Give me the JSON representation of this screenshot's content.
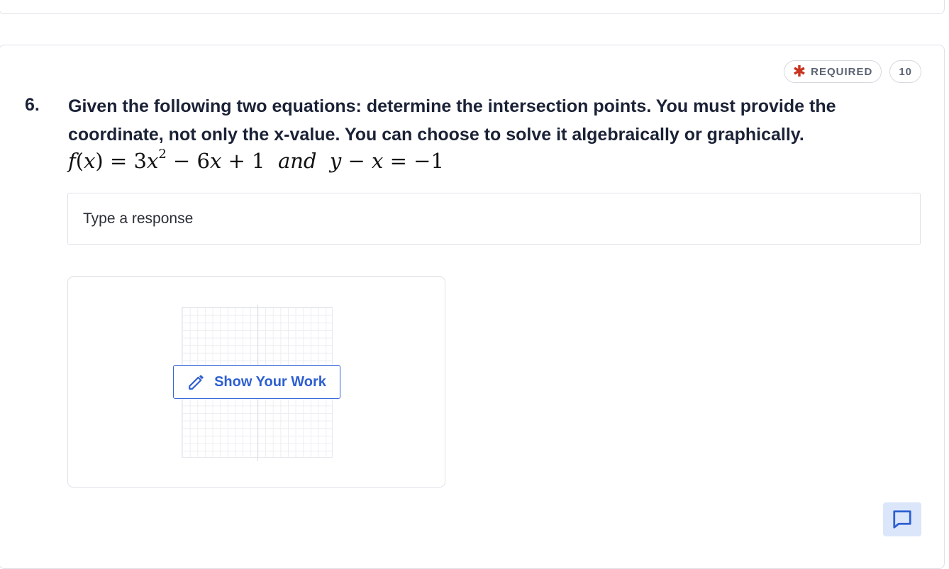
{
  "question": {
    "number": "6.",
    "required_label": "REQUIRED",
    "points": "10",
    "prompt": "Given the following two equations: determine the intersection points. You must provide the coordinate, not only the x-value. You can choose to solve it algebraically or graphically.",
    "math": {
      "f": "f",
      "x": "x",
      "eq": "=",
      "coef": "3",
      "exp": "2",
      "rest": "− 6",
      "const": "+ 1",
      "and": "and",
      "y": "y",
      "minus": "−",
      "rhs": "= −1"
    }
  },
  "response": {
    "placeholder": "Type a response"
  },
  "work": {
    "button_label": "Show Your Work"
  },
  "colors": {
    "accent": "#2d5fd1",
    "required": "#c8321e",
    "chat_bg": "#dbe6fb"
  },
  "icons": {
    "required": "asterisk-icon",
    "edit": "pencil-icon",
    "chat": "chat-bubble-icon"
  }
}
